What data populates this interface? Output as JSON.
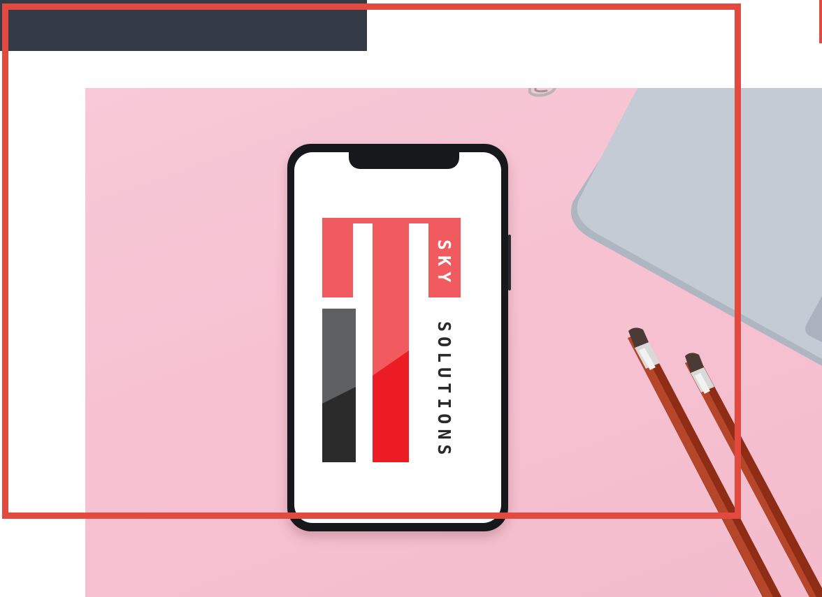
{
  "brand": {
    "line1": "SKY",
    "line2": "SOLUTIONS"
  },
  "colors": {
    "frame": "#e34a3f",
    "top_bar": "#343b46",
    "logo_red": "#f15b5f",
    "logo_deep_red": "#ec1c24",
    "logo_dark": "#2b2b2b",
    "logo_gray": "#5f6062",
    "background_pink": "#f6c2d2"
  },
  "icons": {
    "paper_clip": "paper-clip-icon"
  }
}
